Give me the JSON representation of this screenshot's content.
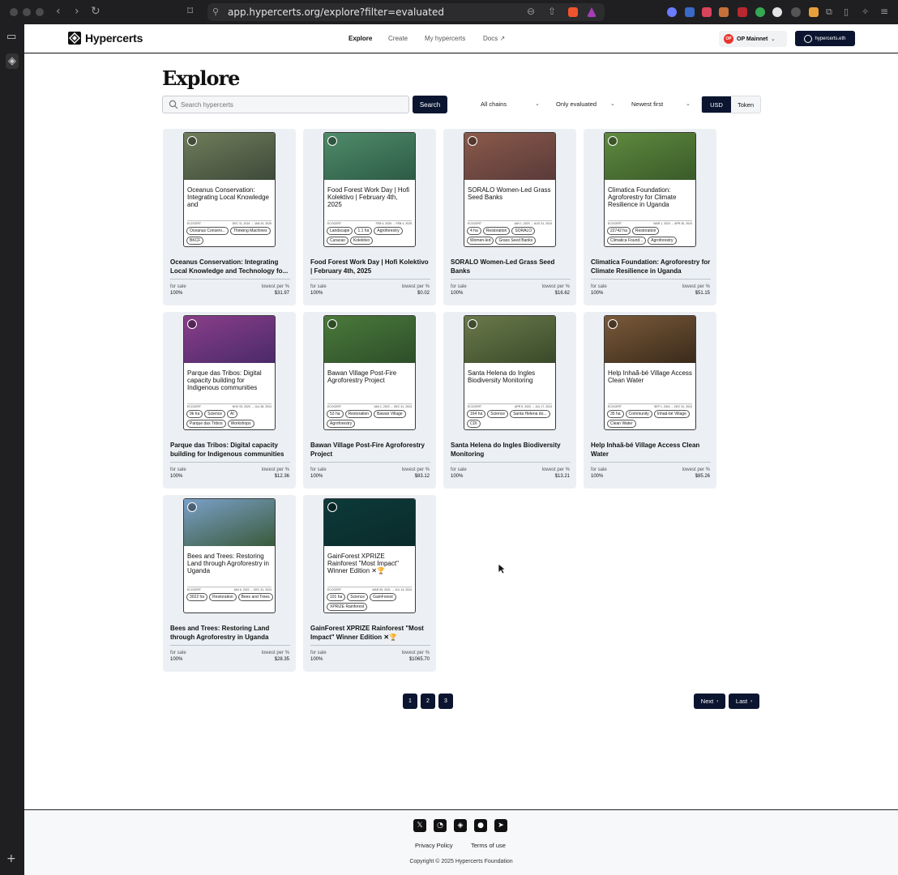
{
  "browser": {
    "url": "app.hypercerts.org/explore?filter=evaluated"
  },
  "header": {
    "brand": "Hypercerts",
    "nav": [
      "Explore",
      "Create",
      "My hypercerts",
      "Docs ↗"
    ],
    "chain": "OP Mainnet",
    "chain_badge": "OP",
    "wallet": "hypercerts.eth"
  },
  "explore": {
    "title": "Explore",
    "search_placeholder": "Search hypercerts",
    "search_button": "Search",
    "filters": [
      "All chains",
      "Only evaluated",
      "Newest first"
    ],
    "currency": [
      "USD",
      "Token"
    ]
  },
  "cards": [
    {
      "mini_title": "Oceanus Conservation: Integrating Local Knowledge and",
      "issuer": "ECOCERT",
      "dates": "DEC 11, 2024 → JAN 24, 2025",
      "tags": [
        "Oceanus Conserv...",
        "Thinking Machines",
        "BKCF"
      ],
      "title": "Oceanus Conservation: Integrating Local Knowledge and Technology fo...",
      "for_sale_label": "for sale",
      "for_sale": "100%",
      "price_label": "lowest per %",
      "price": "$31.97",
      "image_colors": [
        "#6f7d5a",
        "#3e4a3a"
      ]
    },
    {
      "mini_title": "Food Forest Work Day | Hofi Kolektivo | February 4th, 2025",
      "issuer": "ECOCERT",
      "dates": "FEB 4, 2025 → FEB 4, 2025",
      "tags": [
        "Landscape",
        "1.1 ha",
        "Agroforestry",
        "Curacao",
        "Kolektivo"
      ],
      "title": "Food Forest Work Day | Hofi Kolektivo | February 4th, 2025",
      "for_sale_label": "for sale",
      "for_sale": "100%",
      "price_label": "lowest per %",
      "price": "$0.02",
      "image_colors": [
        "#4f8b6a",
        "#2d5b45"
      ]
    },
    {
      "mini_title": "SORALO Women-Led Grass Seed Banks",
      "issuer": "ECOCERT",
      "dates": "JAN 1, 2023 → AUG 31, 2024",
      "tags": [
        "4 ha",
        "Restoration",
        "SORALO",
        "Women-led",
        "Grass Seed Banks"
      ],
      "title": "SORALO Women-Led Grass Seed Banks",
      "for_sale_label": "for sale",
      "for_sale": "100%",
      "price_label": "lowest per %",
      "price": "$16.62",
      "image_colors": [
        "#8a5a4a",
        "#5a3a3a"
      ]
    },
    {
      "mini_title": "Climatica Foundation: Agroforestry for Climate Resilience in Uganda",
      "issuer": "ECOCERT",
      "dates": "MAR 1, 2024 → APR 30, 2024",
      "tags": [
        "22742 ha",
        "Restoration",
        "Climatica Found...",
        "Agroforestry"
      ],
      "title": "Climatica Foundation: Agroforestry for Climate Resilience in Uganda",
      "for_sale_label": "for sale",
      "for_sale": "100%",
      "price_label": "lowest per %",
      "price": "$51.15",
      "image_colors": [
        "#5f8a3e",
        "#3a5a2a"
      ]
    },
    {
      "mini_title": "Parque das Tribos: Digital capacity building for Indigenous communities",
      "issuer": "ECOCERT",
      "dates": "NOV 03, 2023 → JUL 28, 2024",
      "tags": [
        "9k ha",
        "Science",
        "AI",
        "Parque das Tribos",
        "Workshops"
      ],
      "title": "Parque das Tribos: Digital capacity building for Indigenous communities",
      "for_sale_label": "for sale",
      "for_sale": "100%",
      "price_label": "lowest per %",
      "price": "$12.36",
      "image_colors": [
        "#8a3e8a",
        "#4a2a6a"
      ]
    },
    {
      "mini_title": "Bawan Village Post-Fire Agroforestry Project",
      "issuer": "ECOCERT",
      "dates": "JAN 1, 2023 → DEC 31, 2023",
      "tags": [
        "53 ha",
        "Restoration",
        "Bawan Village",
        "Agroforestry"
      ],
      "title": "Bawan Village Post-Fire Agroforestry Project",
      "for_sale_label": "for sale",
      "for_sale": "100%",
      "price_label": "lowest per %",
      "price": "$83.12",
      "image_colors": [
        "#4a7a3a",
        "#2e4e2a"
      ]
    },
    {
      "mini_title": "Santa Helena do Ingles Biodiversity Monitoring",
      "issuer": "ECOCERT",
      "dates": "APR 5, 2024 → JUL 17, 2024",
      "tags": [
        "164 ha",
        "Science",
        "Santa Helena do...",
        "CDI"
      ],
      "title": "Santa Helena do Ingles Biodiversity Monitoring",
      "for_sale_label": "for sale",
      "for_sale": "100%",
      "price_label": "lowest per %",
      "price": "$13.21",
      "image_colors": [
        "#6a7a4a",
        "#3a4a2a"
      ]
    },
    {
      "mini_title": "Help Inhaã-bé Village Access Clean Water",
      "issuer": "ECOCERT",
      "dates": "SEP 1, 2024 → DEC 31, 2024",
      "tags": [
        "35 ha",
        "Community",
        "Inhaã-bé Village",
        "Clean Water"
      ],
      "title": "Help Inhaã-bé Village Access Clean Water",
      "for_sale_label": "for sale",
      "for_sale": "100%",
      "price_label": "lowest per %",
      "price": "$85.26",
      "image_colors": [
        "#7a5a3a",
        "#3a2a1a"
      ]
    },
    {
      "mini_title": "Bees and Trees: Restoring Land through Agroforestry in Uganda",
      "issuer": "ECOCERT",
      "dates": "JAN 6, 2022 → DEC 31, 2024",
      "tags": [
        "3022 ha",
        "Restoration",
        "Bees and Trees"
      ],
      "title": "Bees and Trees: Restoring Land through Agroforestry in Uganda",
      "for_sale_label": "for sale",
      "for_sale": "100%",
      "price_label": "lowest per %",
      "price": "$28.35",
      "image_colors": [
        "#7aa0c8",
        "#3a5a3a"
      ]
    },
    {
      "mini_title": "GainForest XPRIZE Rainforest \"Most Impact\" Winner Edition ✕🏆",
      "issuer": "ECOCERT",
      "dates": "MAR 05, 2021 → JUL 14, 2024",
      "tags": [
        "101 ha",
        "Science",
        "GainForest",
        "XPRIZE Rainforest"
      ],
      "title": "GainForest XPRIZE Rainforest \"Most Impact\" Winner Edition ✕🏆",
      "for_sale_label": "for sale",
      "for_sale": "100%",
      "price_label": "lowest per %",
      "price": "$1065.70",
      "image_colors": [
        "#0d3a3a",
        "#0a2a2a"
      ]
    }
  ],
  "pagination": {
    "pages": [
      "1",
      "2",
      "3"
    ],
    "next": "Next",
    "last": "Last"
  },
  "footer": {
    "social_icons": [
      "x-icon",
      "discord-icon",
      "hypercerts-icon",
      "github-icon",
      "telegram-icon"
    ],
    "links": [
      "Privacy Policy",
      "Terms of use"
    ],
    "copyright": "Copyright © 2025 Hypercerts Foundation"
  },
  "colors": {
    "primary": "#0b1530",
    "card_bg": "#ecf0f4",
    "op_red": "#e8332c"
  }
}
